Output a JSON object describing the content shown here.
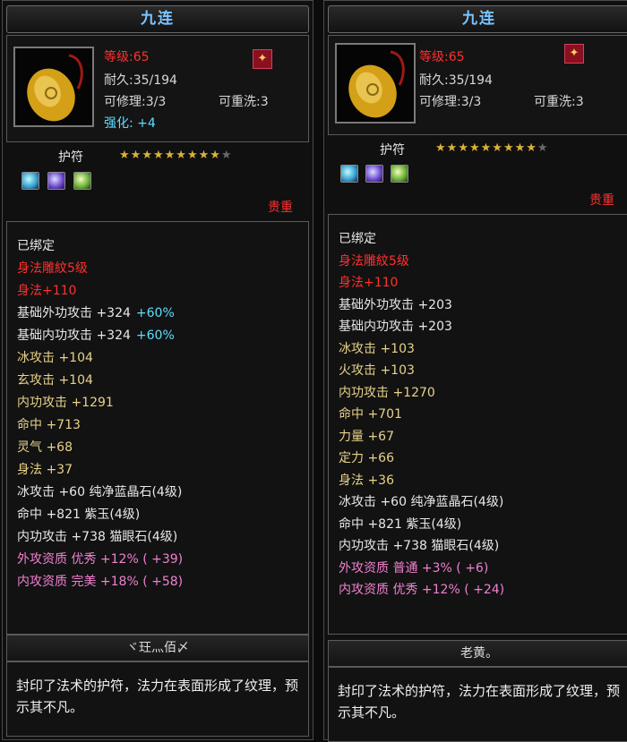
{
  "left": {
    "title": "九连",
    "level": "等级:65",
    "durability": "耐久:35/194",
    "repair": "可修理:3/3",
    "reforge": "可重洗:3",
    "enhance": "强化: +4",
    "badge_icon": "flame-icon",
    "category": "护符",
    "stars": 9,
    "stars_max": 10,
    "gems": [
      "blue-gem-icon",
      "purple-gem-icon",
      "green-gem-icon"
    ],
    "rarity": "贵重",
    "lines": [
      {
        "text": "已绑定",
        "color": "white"
      },
      {
        "text": "身法雕紋5级",
        "color": "red"
      },
      {
        "text": "身法+110",
        "color": "red"
      },
      {
        "text": "基础外功攻击 +324",
        "extra": "+60%",
        "color": "white"
      },
      {
        "text": "基础内功攻击 +324",
        "extra": "+60%",
        "color": "white"
      },
      {
        "text": "冰攻击 +104",
        "color": "yellow"
      },
      {
        "text": "玄攻击 +104",
        "color": "yellow"
      },
      {
        "text": "内功攻击 +1291",
        "color": "yellow"
      },
      {
        "text": "命中 +713",
        "color": "yellow"
      },
      {
        "text": "灵气 +68",
        "color": "yellow"
      },
      {
        "text": "身法 +37",
        "color": "yellow"
      },
      {
        "text": "冰攻击 +60 纯净蓝晶石(4级)",
        "color": "white"
      },
      {
        "text": "命中 +821 紫玉(4级)",
        "color": "white"
      },
      {
        "text": "内功攻击 +738 猫眼石(4级)",
        "color": "white"
      },
      {
        "text": "外攻资质  优秀 +12% ( +39)",
        "color": "pink"
      },
      {
        "text": "内攻资质  完美 +18% ( +58)",
        "color": "pink"
      }
    ],
    "name": "ヾ玨灬佰〆",
    "description": "封印了法术的护符，法力在表面形成了纹理，预示其不凡。"
  },
  "right": {
    "title": "九连",
    "level": "等级:65",
    "durability": "耐久:35/194",
    "repair": "可修理:3/3",
    "reforge": "可重洗:3",
    "badge_icon": "flame-icon",
    "category": "护符",
    "stars": 9,
    "stars_max": 10,
    "gems": [
      "blue-gem-icon",
      "purple-gem-icon",
      "green-gem-icon"
    ],
    "rarity": "贵重",
    "lines": [
      {
        "text": "已绑定",
        "color": "white"
      },
      {
        "text": "身法雕紋5级",
        "color": "red"
      },
      {
        "text": "身法+110",
        "color": "red"
      },
      {
        "text": "基础外功攻击 +203",
        "color": "white"
      },
      {
        "text": "基础内功攻击 +203",
        "color": "white"
      },
      {
        "text": "冰攻击 +103",
        "color": "yellow"
      },
      {
        "text": "火攻击 +103",
        "color": "yellow"
      },
      {
        "text": "内功攻击 +1270",
        "color": "yellow"
      },
      {
        "text": "命中 +701",
        "color": "yellow"
      },
      {
        "text": "力量 +67",
        "color": "yellow"
      },
      {
        "text": "定力 +66",
        "color": "yellow"
      },
      {
        "text": "身法 +36",
        "color": "yellow"
      },
      {
        "text": "冰攻击 +60 纯净蓝晶石(4级)",
        "color": "white"
      },
      {
        "text": "命中 +821 紫玉(4级)",
        "color": "white"
      },
      {
        "text": "内功攻击 +738 猫眼石(4级)",
        "color": "white"
      },
      {
        "text": "外攻资质  普通 +3% ( +6)",
        "color": "pink"
      },
      {
        "text": "内攻资质  优秀 +12% ( +24)",
        "color": "pink"
      }
    ],
    "name": "老黄。",
    "description": "封印了法术的护符，法力在表面形成了纹理，预示其不凡。"
  }
}
